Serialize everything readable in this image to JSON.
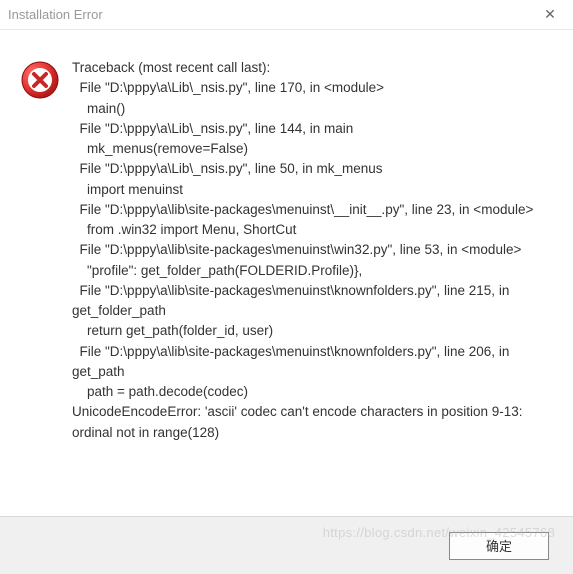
{
  "titlebar": {
    "title": "Installation Error",
    "close_label": "✕"
  },
  "icon": {
    "name": "error-icon"
  },
  "traceback": {
    "header": "Traceback (most recent call last):",
    "lines": [
      "  File \"D:\\pppy\\a\\Lib\\_nsis.py\", line 170, in <module>",
      "    main()",
      "  File \"D:\\pppy\\a\\Lib\\_nsis.py\", line 144, in main",
      "    mk_menus(remove=False)",
      "  File \"D:\\pppy\\a\\Lib\\_nsis.py\", line 50, in mk_menus",
      "    import menuinst",
      "  File \"D:\\pppy\\a\\lib\\site-packages\\menuinst\\__init__.py\", line 23, in <module>",
      "    from .win32 import Menu, ShortCut",
      "  File \"D:\\pppy\\a\\lib\\site-packages\\menuinst\\win32.py\", line 53, in <module>",
      "    \"profile\": get_folder_path(FOLDERID.Profile)},",
      "  File \"D:\\pppy\\a\\lib\\site-packages\\menuinst\\knownfolders.py\", line 215, in get_folder_path",
      "    return get_path(folder_id, user)",
      "  File \"D:\\pppy\\a\\lib\\site-packages\\menuinst\\knownfolders.py\", line 206, in get_path",
      "    path = path.decode(codec)",
      "UnicodeEncodeError: 'ascii' codec can't encode characters in position 9-13: ordinal not in range(128)"
    ]
  },
  "buttons": {
    "ok_label": "确定"
  },
  "watermark": {
    "text": "https://blog.csdn.net/weixin_42545768"
  }
}
